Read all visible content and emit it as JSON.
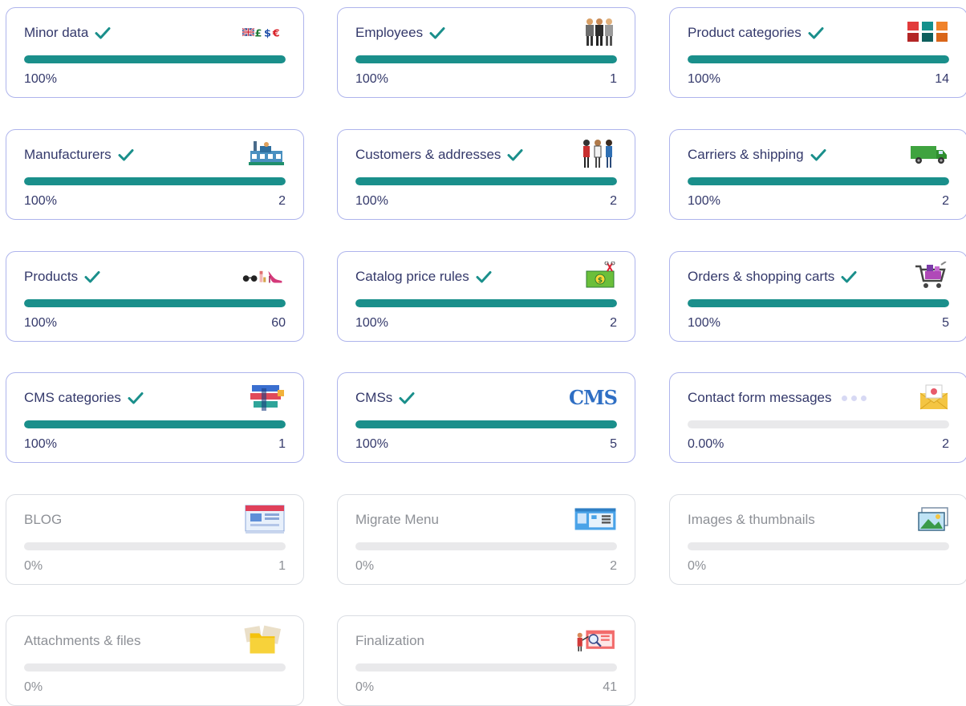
{
  "accent_color": "#1a8f8b",
  "cards": [
    {
      "title": "Minor data",
      "status": "done",
      "percent_label": "100%",
      "progress": 1.0,
      "count": "",
      "icon": "currency-flags-icon"
    },
    {
      "title": "Employees",
      "status": "done",
      "percent_label": "100%",
      "progress": 1.0,
      "count": "1",
      "icon": "employees-icon"
    },
    {
      "title": "Product categories",
      "status": "done",
      "percent_label": "100%",
      "progress": 1.0,
      "count": "14",
      "icon": "category-grid-icon"
    },
    {
      "title": "Manufacturers",
      "status": "done",
      "percent_label": "100%",
      "progress": 1.0,
      "count": "2",
      "icon": "factory-icon"
    },
    {
      "title": "Customers & addresses",
      "status": "done",
      "percent_label": "100%",
      "progress": 1.0,
      "count": "2",
      "icon": "customers-icon"
    },
    {
      "title": "Carriers & shipping",
      "status": "done",
      "percent_label": "100%",
      "progress": 1.0,
      "count": "2",
      "icon": "truck-icon"
    },
    {
      "title": "Products",
      "status": "done",
      "percent_label": "100%",
      "progress": 1.0,
      "count": "60",
      "icon": "products-icon"
    },
    {
      "title": "Catalog price rules",
      "status": "done",
      "percent_label": "100%",
      "progress": 1.0,
      "count": "2",
      "icon": "price-tag-icon"
    },
    {
      "title": "Orders & shopping carts",
      "status": "done",
      "percent_label": "100%",
      "progress": 1.0,
      "count": "5",
      "icon": "shopping-cart-icon"
    },
    {
      "title": "CMS categories",
      "status": "done",
      "percent_label": "100%",
      "progress": 1.0,
      "count": "1",
      "icon": "cms-categories-icon"
    },
    {
      "title": "CMSs",
      "status": "done",
      "percent_label": "100%",
      "progress": 1.0,
      "count": "5",
      "icon": "cms-text-icon",
      "icon_text": "CMS"
    },
    {
      "title": "Contact form messages",
      "status": "in-progress",
      "percent_label": "0.00%",
      "progress": 0.0,
      "count": "2",
      "icon": "envelope-icon"
    },
    {
      "title": "BLOG",
      "status": "pending",
      "percent_label": "0%",
      "progress": 0.0,
      "count": "1",
      "icon": "blog-page-icon"
    },
    {
      "title": "Migrate Menu",
      "status": "pending",
      "percent_label": "0%",
      "progress": 0.0,
      "count": "2",
      "icon": "menu-window-icon"
    },
    {
      "title": "Images & thumbnails",
      "status": "pending",
      "percent_label": "0%",
      "progress": 0.0,
      "count": "",
      "icon": "picture-icon"
    },
    {
      "title": "Attachments & files",
      "status": "pending",
      "percent_label": "0%",
      "progress": 0.0,
      "count": "",
      "icon": "folder-icon"
    },
    {
      "title": "Finalization",
      "status": "pending",
      "percent_label": "0%",
      "progress": 0.0,
      "count": "41",
      "icon": "finalization-icon"
    }
  ]
}
